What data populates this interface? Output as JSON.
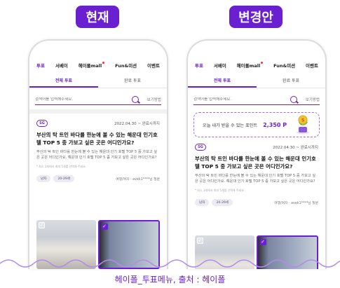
{
  "labels": {
    "current": "현재",
    "changed": "변경안"
  },
  "nav": {
    "items": [
      "투표",
      "서베이",
      "헤이폴mall",
      "Fun&미션",
      "이벤트"
    ],
    "active_index": 0
  },
  "tabs": [
    "전체 투표",
    "완료 투표"
  ],
  "search": {
    "placeholder": "검색어를 입력해주세요.",
    "view_all": "보기방법"
  },
  "point_banner": {
    "label": "오늘 내가 받을 수 있는 포인트",
    "value": "2,350 P"
  },
  "card": {
    "badge": "SG",
    "date": "2022.04.30 ~ 완료시까지",
    "title": "부산의 탁 트인 바다를 한눈에 볼 수 있는 해운대 인기호텔 TOP 5 중 가보고 싶은 곳은 어디인가요?",
    "desc": "부산의 탁 트인 바다를 한눈에 볼 수 있는 해운대 인기 호텔 TOP 5 중 가보고 싶은 곳은 어디인가요. 해운대 인기 호텔 TOP 5 중 가보고 싶은 곳은 어디인가요?",
    "note": "* 최소 1개에서 최대 5개를 선택해 주세요.",
    "chips": [
      "남자",
      "20-29세"
    ],
    "author": "여행/여자 · avek1****님 질문"
  },
  "caption": "헤이폴_투표메뉴, 출처 : 헤이폴",
  "colors": {
    "accent": "#6a1fd1"
  }
}
